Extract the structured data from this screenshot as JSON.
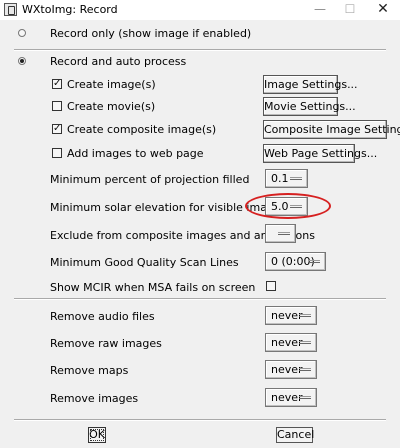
{
  "window": {
    "title": "WXtoImg: Record",
    "minimize_glyph": "—",
    "maximize_glyph": "☐",
    "close_glyph": "✕"
  },
  "mode": {
    "record_only": "Record only (show image if enabled)",
    "record_auto": "Record and auto process",
    "selected": "record_auto"
  },
  "options": {
    "create_images": {
      "label": "Create image(s)",
      "checked": true,
      "button": "Image Settings..."
    },
    "create_movies": {
      "label": "Create movie(s)",
      "checked": false,
      "button": "Movie Settings..."
    },
    "create_composite": {
      "label": "Create composite image(s)",
      "checked": true,
      "button": "Composite Image Settings..."
    },
    "add_web": {
      "label": "Add images to web page",
      "checked": false,
      "button": "Web Page Settings..."
    }
  },
  "settings": {
    "min_projection": {
      "label": "Minimum percent of projection filled",
      "value": "0.1"
    },
    "min_solar": {
      "label": "Minimum solar elevation for visible images",
      "value": "5.0"
    },
    "exclude_composite": {
      "label": "Exclude from composite images and animations",
      "value": ""
    },
    "min_scan_lines": {
      "label": "Minimum Good Quality Scan Lines",
      "value": "0 (0:00)"
    },
    "show_mcir": {
      "label": "Show MCIR when MSA fails on screen",
      "checked": false
    }
  },
  "remove": {
    "audio": {
      "label": "Remove audio files",
      "value": "never"
    },
    "raw": {
      "label": "Remove raw images",
      "value": "never"
    },
    "maps": {
      "label": "Remove maps",
      "value": "never"
    },
    "images": {
      "label": "Remove images",
      "value": "never"
    }
  },
  "buttons": {
    "ok": "OK",
    "cancel": "Cancel"
  },
  "colors": {
    "highlight_ellipse": "#d62020"
  }
}
